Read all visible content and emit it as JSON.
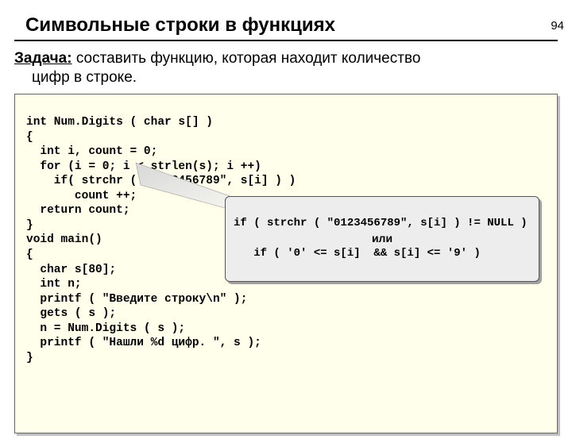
{
  "page_number": "94",
  "title": "Символьные строки в функциях",
  "task_label": "Задача:",
  "task_text_line1": " составить функцию, которая находит количество",
  "task_text_line2": "цифр в строке.",
  "code": {
    "l01": "int Num.Digits ( char s[] )",
    "l02": "{",
    "l03": "  int i, count = 0;",
    "l04": "  for (i = 0; i < strlen(s); i ++)",
    "l05": "    if( strchr ( \"0123456789\", s[i] ) )",
    "l06": "       count ++;",
    "l07": "  return count;",
    "l08": "}",
    "l09": "void main()",
    "l10": "{",
    "l11": "  char s[80];",
    "l12": "  int n;",
    "l13": "  printf ( \"Введите строку\\n\" );",
    "l14": "  gets ( s );",
    "l15": "  n = Num.Digits ( s );",
    "l16": "  printf ( \"Нашли %d цифр. \", s );",
    "l17": "}"
  },
  "callout": {
    "line1": "if ( strchr ( \"0123456789\", s[i] ) != NULL )",
    "or": "или",
    "line2": "   if ( '0' <= s[i]  && s[i] <= '9' )"
  }
}
